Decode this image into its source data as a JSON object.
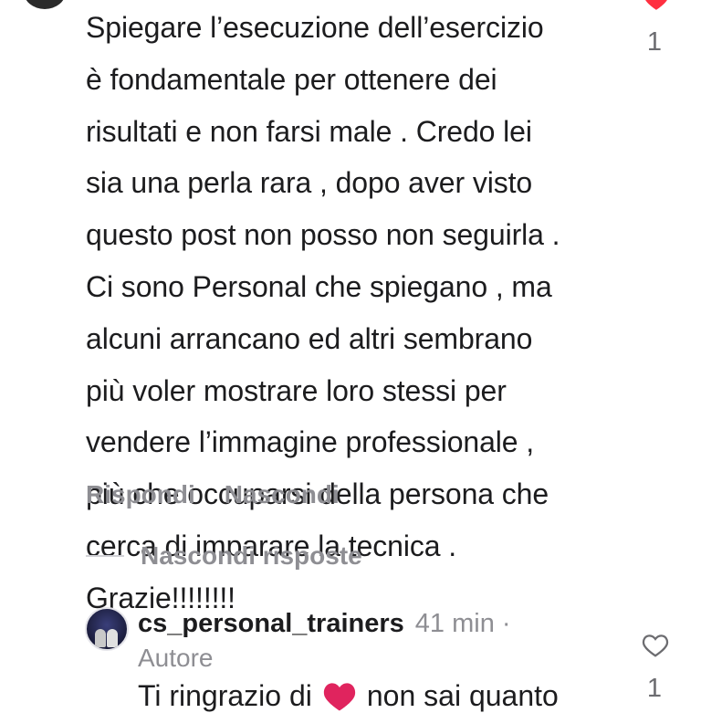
{
  "comment": {
    "text": "Spiegare l’esecuzione dell’esercizio\nè fondamentale per ottenere dei\nrisultati e non farsi male . Credo lei\nsia una perla rara , dopo aver visto\nquesto post non posso non seguirla .\nCi sono Personal che spiegano , ma\nalcuni arrancano ed altri sembrano\npiù voler mostrare loro stessi per\nvendere l’immagine professionale ,\npiù che occuparsi della persona che\ncerca di imparare la tecnica .\nGrazie!!!!!!!!",
    "like_count": "1",
    "reply_label": "Rispondi",
    "hide_label": "Nascondi"
  },
  "replies_toggle": {
    "label": "Nascondi risposte"
  },
  "reply": {
    "username": "cs_personal_trainers",
    "time": "41 min",
    "separator": "·",
    "author_badge": "Autore",
    "text_before": "Ti ringrazio di",
    "text_after": "non sai quanto",
    "like_count": "1"
  },
  "colors": {
    "heart_red": "#ff3040",
    "muted_gray": "#8e8e93",
    "text_primary": "#1c1c1e"
  },
  "icons": {
    "liked_heart": "heart-filled-icon",
    "like_outline": "heart-outline-icon",
    "emoji_heart": "red-heart-emoji"
  }
}
